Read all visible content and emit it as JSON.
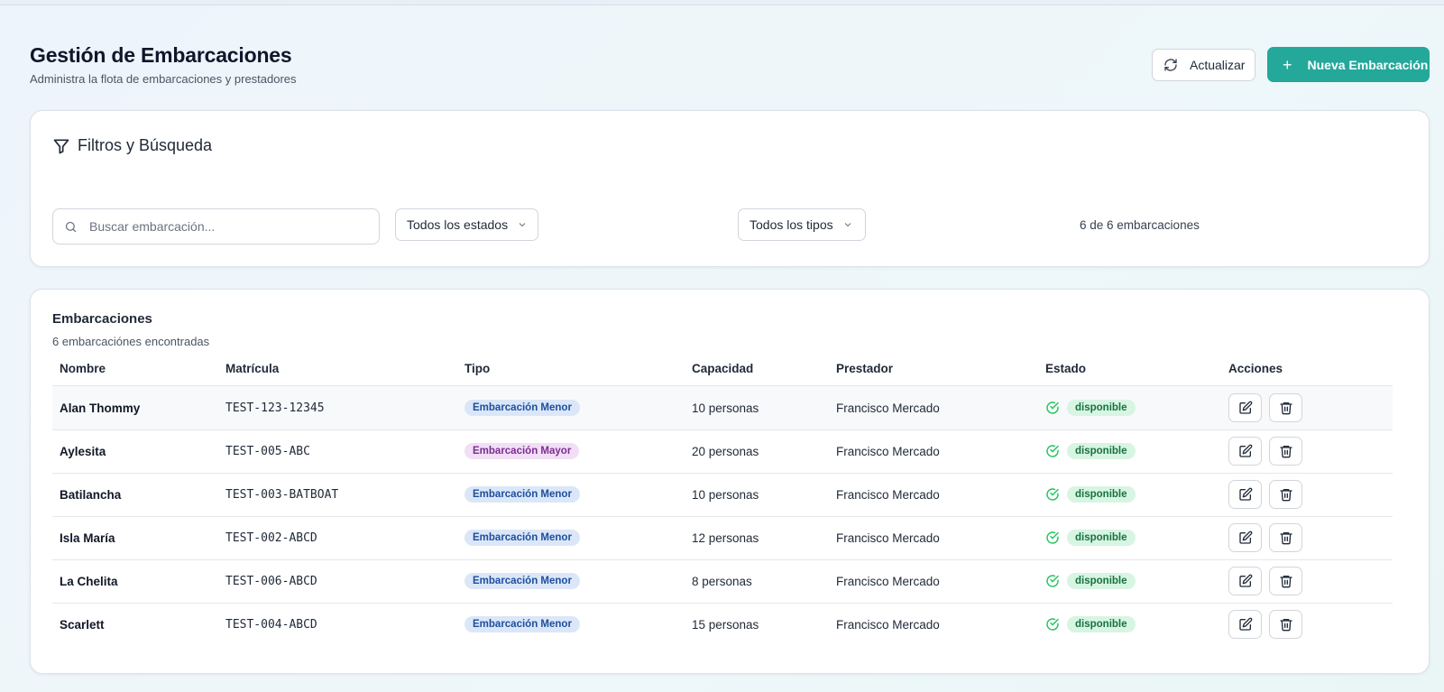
{
  "header": {
    "title": "Gestión de Embarcaciones",
    "subtitle": "Administra la flota de embarcaciones y prestadores",
    "refresh_label": "Actualizar",
    "new_label": "Nueva Embarcación"
  },
  "filters": {
    "title": "Filtros y Búsqueda",
    "search_placeholder": "Buscar embarcación...",
    "status_select": "Todos los estados",
    "type_select": "Todos los tipos",
    "count_text": "6 de 6 embarcaciones"
  },
  "table": {
    "title": "Embarcaciones",
    "subtitle": "6 embarcaciónes encontradas",
    "columns": [
      "Nombre",
      "Matrícula",
      "Tipo",
      "Capacidad",
      "Prestador",
      "Estado",
      "Acciones"
    ],
    "rows": [
      {
        "nombre": "Alan Thommy",
        "matricula": "TEST-123-12345",
        "tipo": "Embarcación Menor",
        "capacidad": "10 personas",
        "prestador": "Francisco Mercado",
        "estado": "disponible"
      },
      {
        "nombre": "Aylesita",
        "matricula": "TEST-005-ABC",
        "tipo": "Embarcación Mayor",
        "capacidad": "20 personas",
        "prestador": "Francisco Mercado",
        "estado": "disponible"
      },
      {
        "nombre": "Batilancha",
        "matricula": "TEST-003-BATBOAT",
        "tipo": "Embarcación Menor",
        "capacidad": "10 personas",
        "prestador": "Francisco Mercado",
        "estado": "disponible"
      },
      {
        "nombre": "Isla María",
        "matricula": "TEST-002-ABCD",
        "tipo": "Embarcación Menor",
        "capacidad": "12 personas",
        "prestador": "Francisco Mercado",
        "estado": "disponible"
      },
      {
        "nombre": "La Chelita",
        "matricula": "TEST-006-ABCD",
        "tipo": "Embarcación Menor",
        "capacidad": "8 personas",
        "prestador": "Francisco Mercado",
        "estado": "disponible"
      },
      {
        "nombre": "Scarlett",
        "matricula": "TEST-004-ABCD",
        "tipo": "Embarcación Menor",
        "capacidad": "15 personas",
        "prestador": "Francisco Mercado",
        "estado": "disponible"
      }
    ]
  },
  "colors": {
    "accent": "#23a89a",
    "status_green": "#22c55e",
    "badge_menor_bg": "#dbe7f8",
    "badge_mayor_bg": "#f1dff5"
  },
  "icons": {
    "refresh": "refresh-icon",
    "add": "plus-icon",
    "filter": "filter-icon",
    "search": "search-icon",
    "dropdown": "chevron-down-icon",
    "status": "check-circle-icon",
    "edit": "edit-icon",
    "delete": "trash-icon"
  }
}
